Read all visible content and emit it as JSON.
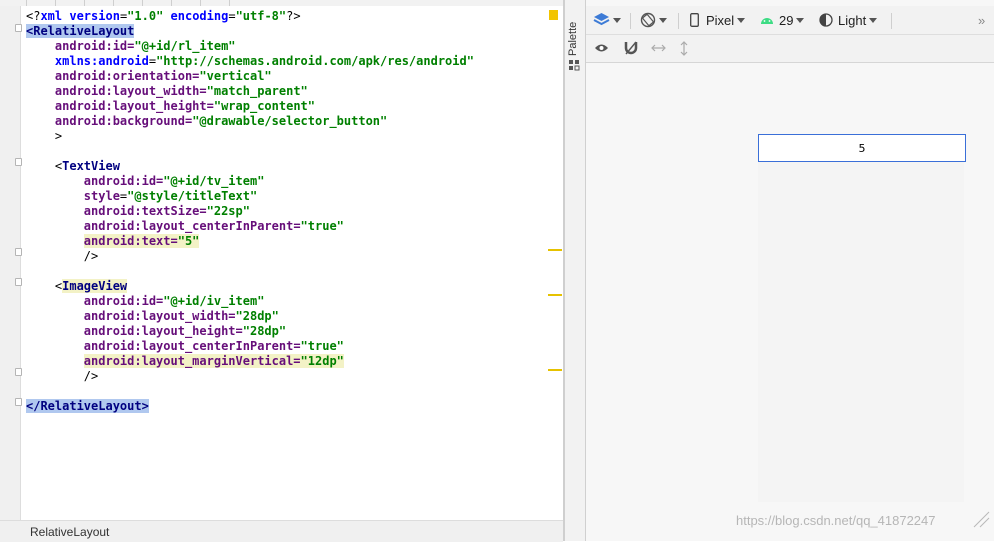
{
  "editor": {
    "lines": [
      {
        "segments": [
          {
            "t": "<?",
            "c": "plain"
          },
          {
            "t": "xml version",
            "c": "ns"
          },
          {
            "t": "=",
            "c": "plain"
          },
          {
            "t": "\"1.0\"",
            "c": "val"
          },
          {
            "t": " encoding",
            "c": "ns"
          },
          {
            "t": "=",
            "c": "plain"
          },
          {
            "t": "\"utf-8\"",
            "c": "val"
          },
          {
            "t": "?>",
            "c": "plain"
          }
        ]
      },
      {
        "segments": [
          {
            "t": "<RelativeLayout",
            "c": "tag hl-tag"
          }
        ]
      },
      {
        "segments": [
          {
            "t": "    android",
            "c": "attr"
          },
          {
            "t": ":id=",
            "c": "attr"
          },
          {
            "t": "\"@+id/rl_item\"",
            "c": "val"
          }
        ]
      },
      {
        "segments": [
          {
            "t": "    xmlns:android",
            "c": "ns"
          },
          {
            "t": "=",
            "c": "plain"
          },
          {
            "t": "\"http://schemas.android.com/apk/res/android\"",
            "c": "val"
          }
        ]
      },
      {
        "segments": [
          {
            "t": "    android",
            "c": "attr"
          },
          {
            "t": ":orientation=",
            "c": "attr"
          },
          {
            "t": "\"vertical\"",
            "c": "val"
          }
        ]
      },
      {
        "segments": [
          {
            "t": "    android",
            "c": "attr"
          },
          {
            "t": ":layout_width=",
            "c": "attr"
          },
          {
            "t": "\"match_parent\"",
            "c": "val"
          }
        ]
      },
      {
        "segments": [
          {
            "t": "    android",
            "c": "attr"
          },
          {
            "t": ":layout_height=",
            "c": "attr"
          },
          {
            "t": "\"wrap_content\"",
            "c": "val"
          }
        ]
      },
      {
        "segments": [
          {
            "t": "    android",
            "c": "attr"
          },
          {
            "t": ":background=",
            "c": "attr"
          },
          {
            "t": "\"@drawable/selector_button\"",
            "c": "val"
          }
        ]
      },
      {
        "segments": [
          {
            "t": "    >",
            "c": "plain"
          }
        ]
      },
      {
        "segments": []
      },
      {
        "segments": [
          {
            "t": "    <",
            "c": "plain"
          },
          {
            "t": "TextView",
            "c": "tag"
          }
        ]
      },
      {
        "segments": [
          {
            "t": "        android",
            "c": "attr"
          },
          {
            "t": ":id=",
            "c": "attr"
          },
          {
            "t": "\"@+id/tv_item\"",
            "c": "val"
          }
        ]
      },
      {
        "segments": [
          {
            "t": "        style",
            "c": "attr"
          },
          {
            "t": "=",
            "c": "plain"
          },
          {
            "t": "\"@style/titleText\"",
            "c": "val"
          }
        ]
      },
      {
        "segments": [
          {
            "t": "        android",
            "c": "attr"
          },
          {
            "t": ":textSize=",
            "c": "attr"
          },
          {
            "t": "\"22sp\"",
            "c": "val"
          }
        ]
      },
      {
        "segments": [
          {
            "t": "        android",
            "c": "attr"
          },
          {
            "t": ":layout_centerInParent=",
            "c": "attr"
          },
          {
            "t": "\"true\"",
            "c": "val"
          }
        ]
      },
      {
        "segments": [
          {
            "t": "        ",
            "c": "plain"
          },
          {
            "t": "android:text=",
            "c": "attr hl-yellow"
          },
          {
            "t": "\"5\"",
            "c": "val hl-yellow"
          }
        ]
      },
      {
        "segments": [
          {
            "t": "        />",
            "c": "plain"
          }
        ]
      },
      {
        "segments": []
      },
      {
        "segments": [
          {
            "t": "    <",
            "c": "plain"
          },
          {
            "t": "ImageView",
            "c": "tag hl-yellow"
          }
        ]
      },
      {
        "segments": [
          {
            "t": "        android",
            "c": "attr"
          },
          {
            "t": ":id=",
            "c": "attr"
          },
          {
            "t": "\"@+id/iv_item\"",
            "c": "val"
          }
        ]
      },
      {
        "segments": [
          {
            "t": "        android",
            "c": "attr"
          },
          {
            "t": ":layout_width=",
            "c": "attr"
          },
          {
            "t": "\"28dp\"",
            "c": "val"
          }
        ]
      },
      {
        "segments": [
          {
            "t": "        android",
            "c": "attr"
          },
          {
            "t": ":layout_height=",
            "c": "attr"
          },
          {
            "t": "\"28dp\"",
            "c": "val"
          }
        ]
      },
      {
        "segments": [
          {
            "t": "        android",
            "c": "attr"
          },
          {
            "t": ":layout_centerInParent=",
            "c": "attr"
          },
          {
            "t": "\"true\"",
            "c": "val"
          }
        ]
      },
      {
        "segments": [
          {
            "t": "        ",
            "c": "plain"
          },
          {
            "t": "android:layout_marginVertical=",
            "c": "attr hl-yellow"
          },
          {
            "t": "\"12dp\"",
            "c": "val hl-yellow"
          }
        ]
      },
      {
        "segments": [
          {
            "t": "        />",
            "c": "plain"
          }
        ]
      },
      {
        "segments": []
      },
      {
        "segments": [
          {
            "t": "</RelativeLayout>",
            "c": "tag hl-tag"
          }
        ]
      }
    ]
  },
  "status_bar": {
    "breadcrumb": "RelativeLayout"
  },
  "palette": {
    "label": "Palette"
  },
  "toolbar": {
    "device": "Pixel",
    "api_level": "29",
    "theme": "Light",
    "overflow": "»"
  },
  "preview": {
    "item_text": "5"
  },
  "watermark": "https://blog.csdn.net/qq_41872247",
  "icons": [
    "layers-icon",
    "orientation-icon",
    "phone-icon",
    "android-icon",
    "theme-icon",
    "eye-icon",
    "magnet-icon",
    "horizontal-arrows-icon",
    "vertical-arrows-icon",
    "palette-icon"
  ]
}
